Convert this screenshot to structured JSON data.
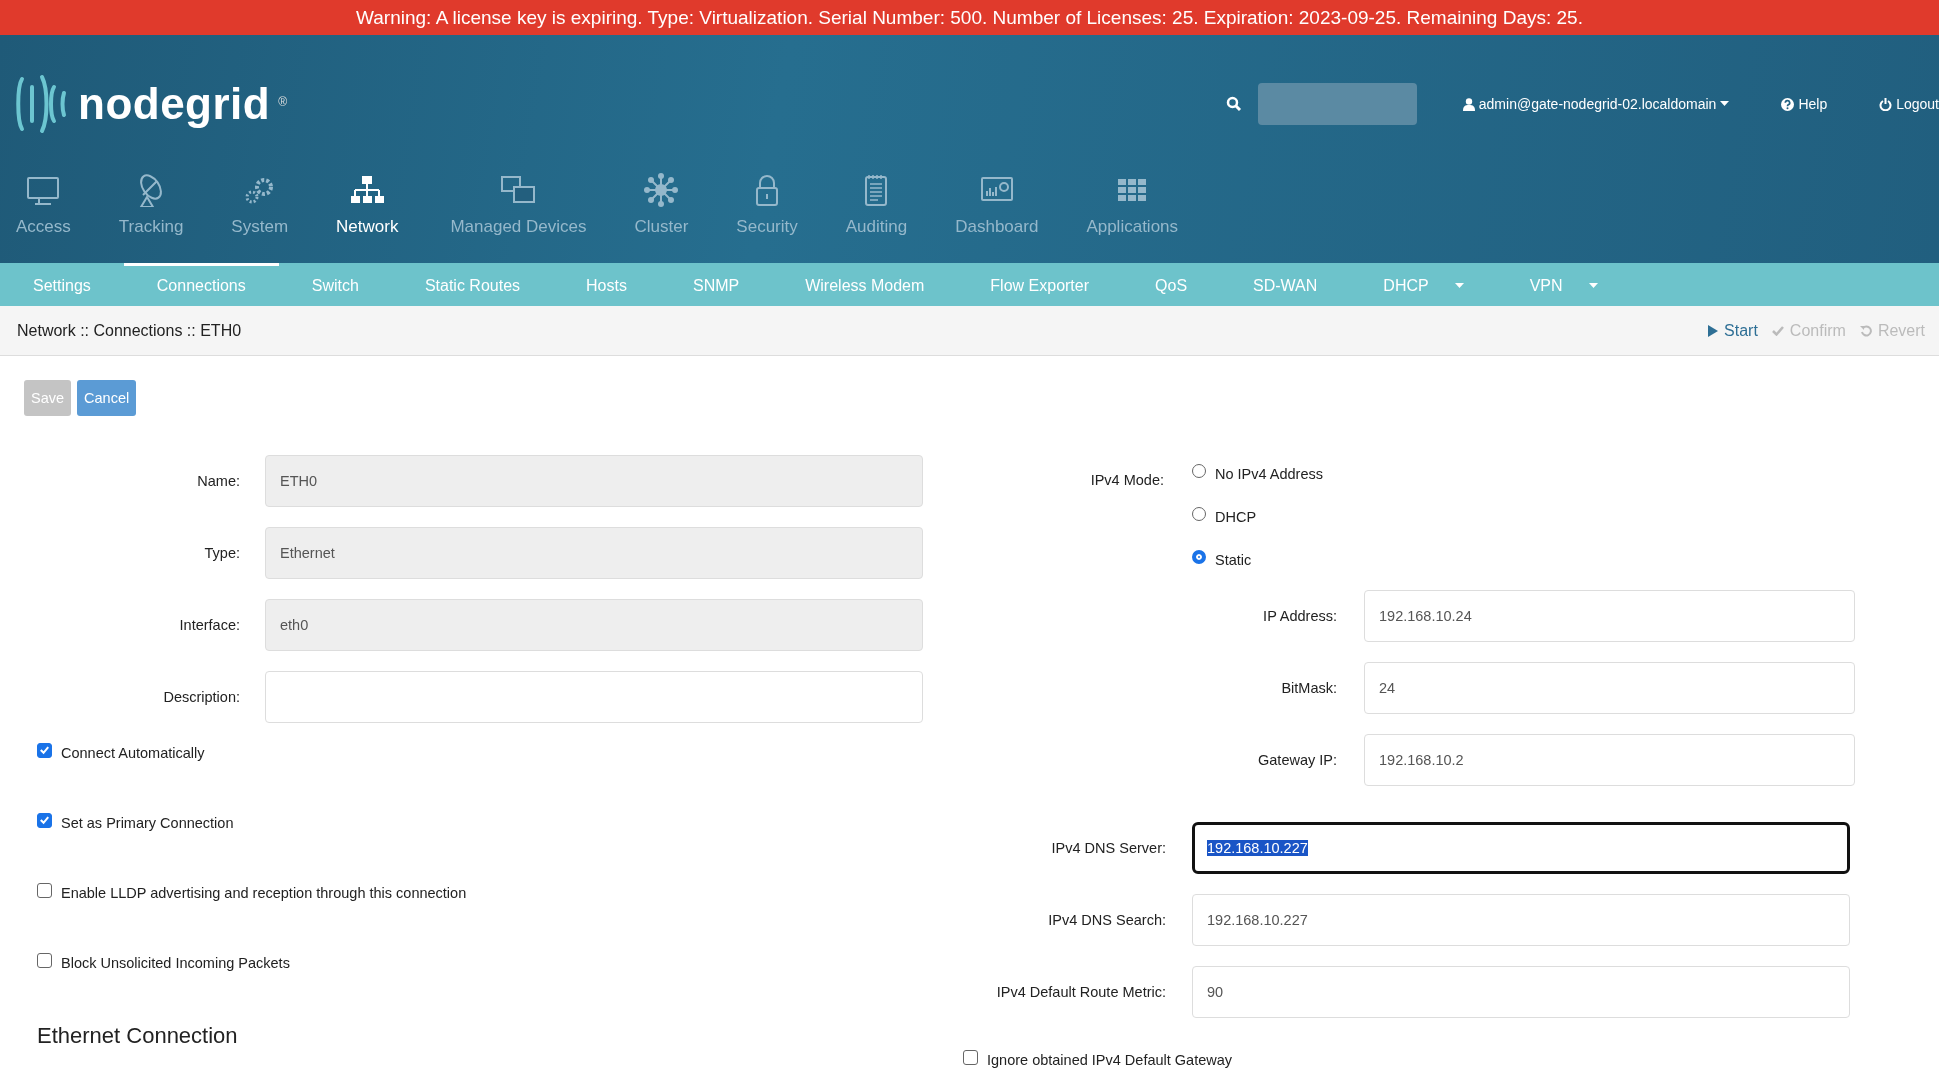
{
  "warning_banner": "Warning: A license key is expiring. Type: Virtualization. Serial Number: 500. Number of Licenses: 25. Expiration: 2023-09-25. Remaining Days: 25.",
  "header": {
    "logo_text": "nodegrid",
    "registered_mark": "®",
    "user_menu": "admin@gate-nodegrid-02.localdomain",
    "help": "Help",
    "logout": "Logout"
  },
  "main_nav": [
    {
      "label": "Access",
      "selected": false
    },
    {
      "label": "Tracking",
      "selected": false
    },
    {
      "label": "System",
      "selected": false
    },
    {
      "label": "Network",
      "selected": true
    },
    {
      "label": "Managed Devices",
      "selected": false
    },
    {
      "label": "Cluster",
      "selected": false
    },
    {
      "label": "Security",
      "selected": false
    },
    {
      "label": "Auditing",
      "selected": false
    },
    {
      "label": "Dashboard",
      "selected": false
    },
    {
      "label": "Applications",
      "selected": false
    }
  ],
  "sub_nav": [
    {
      "label": "Settings",
      "selected": false,
      "dropdown": false
    },
    {
      "label": "Connections",
      "selected": true,
      "dropdown": false
    },
    {
      "label": "Switch",
      "selected": false,
      "dropdown": false
    },
    {
      "label": "Static Routes",
      "selected": false,
      "dropdown": false
    },
    {
      "label": "Hosts",
      "selected": false,
      "dropdown": false
    },
    {
      "label": "SNMP",
      "selected": false,
      "dropdown": false
    },
    {
      "label": "Wireless Modem",
      "selected": false,
      "dropdown": false
    },
    {
      "label": "Flow Exporter",
      "selected": false,
      "dropdown": false
    },
    {
      "label": "QoS",
      "selected": false,
      "dropdown": false
    },
    {
      "label": "SD-WAN",
      "selected": false,
      "dropdown": false
    },
    {
      "label": "DHCP",
      "selected": false,
      "dropdown": true
    },
    {
      "label": "VPN",
      "selected": false,
      "dropdown": true
    }
  ],
  "breadcrumb": "Network :: Connections :: ETH0",
  "actions": [
    {
      "label": "Start",
      "disabled": false
    },
    {
      "label": "Confirm",
      "disabled": true
    },
    {
      "label": "Revert",
      "disabled": true
    }
  ],
  "buttons": [
    {
      "label": "Save",
      "disabled": true
    },
    {
      "label": "Cancel",
      "disabled": false
    }
  ],
  "fields": [
    {
      "label": "Name:",
      "value": "ETH0",
      "disabled": true
    },
    {
      "label": "Type:",
      "value": "Ethernet",
      "disabled": true
    },
    {
      "label": "Interface:",
      "value": "eth0",
      "disabled": true
    },
    {
      "label": "Description:",
      "disabled": false
    }
  ],
  "checkboxes": [
    {
      "label": "Connect Automatically",
      "checked": true
    },
    {
      "label": "Set as Primary Connection",
      "checked": true
    },
    {
      "label": "Enable LLDP advertising and reception through this connection",
      "checked": false
    },
    {
      "label": "Block Unsolicited Incoming Packets",
      "checked": false
    }
  ],
  "section_title": "Ethernet Connection",
  "ipv4_mode": {
    "label": "IPv4 Mode:",
    "options": [
      {
        "label": "No IPv4 Address",
        "selected": false
      },
      {
        "label": "DHCP",
        "selected": false
      },
      {
        "label": "Static",
        "selected": true
      }
    ]
  },
  "static_fields": [
    {
      "label": "IP Address:",
      "value": "192.168.10.24"
    },
    {
      "label": "BitMask:",
      "value": "24"
    },
    {
      "label": "Gateway IP:",
      "value": "192.168.10.2"
    }
  ],
  "dns_fields": [
    {
      "label": "IPv4 DNS Server:",
      "value": "192.168.10.227",
      "focused": true
    },
    {
      "label": "IPv4 DNS Search:",
      "value": "192.168.10.227",
      "focused": false
    },
    {
      "label": "IPv4 Default Route Metric:",
      "value": "90",
      "focused": false
    }
  ],
  "ignore_gateway": {
    "label": "Ignore obtained IPv4 Default Gateway",
    "checked": false
  }
}
